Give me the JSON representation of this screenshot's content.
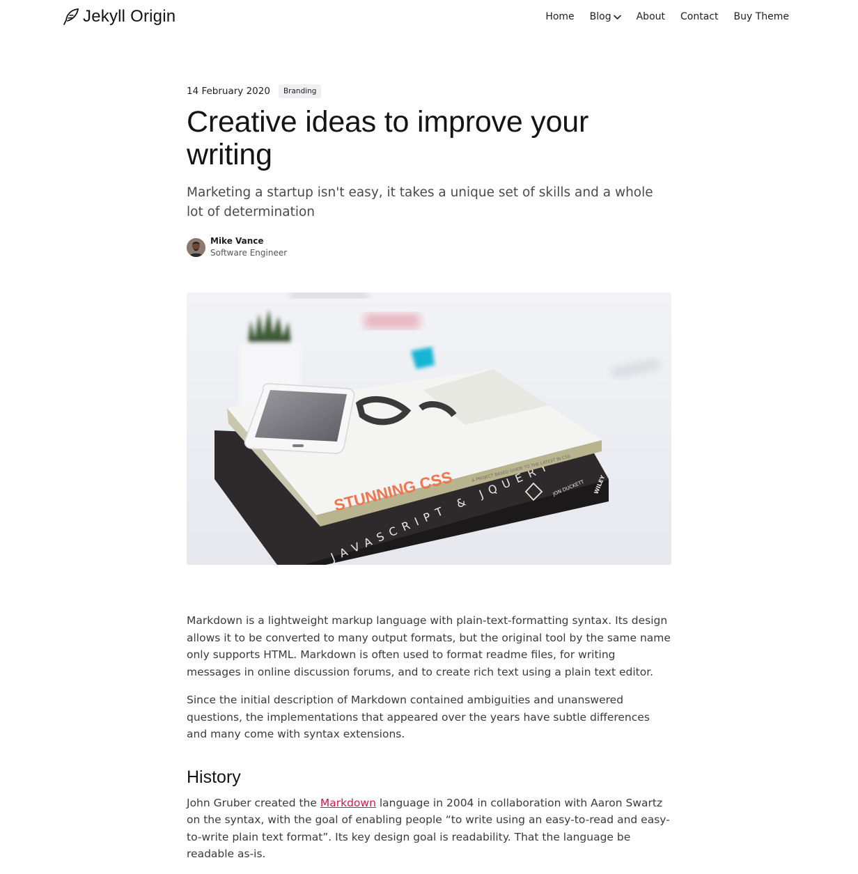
{
  "header": {
    "logo_text": "Jekyll Origin",
    "logo_icon": "quill-icon",
    "nav": [
      {
        "label": "Home"
      },
      {
        "label": "Blog",
        "has_dropdown": true
      },
      {
        "label": "About"
      },
      {
        "label": "Contact"
      },
      {
        "label": "Buy Theme"
      }
    ]
  },
  "post": {
    "date": "14 February 2020",
    "tag": "Branding",
    "title": "Creative ideas to improve your writing",
    "lead": "Marketing a startup isn't easy, it takes a unique set of skills and a whole lot of determination",
    "author": {
      "name": "Mike Vance",
      "role": "Software Engineer"
    },
    "hero_image": {
      "book_top_title": "STUNNING CSS",
      "book_top_subtitle": "A PROJECT BASED GUIDE TO THE LATEST IN CSS",
      "book_bottom_title": "JAVASCRIPT & JQUERY",
      "book_bottom_author": "JON DUCKETT",
      "book_bottom_publisher": "WILEY"
    },
    "body": {
      "p1": "Markdown is a lightweight markup language with plain-text-formatting syntax. Its design allows it to be converted to many output formats, but the original tool by the same name only supports HTML. Markdown is often used to format readme files, for writing messages in online discussion forums, and to create rich text using a plain text editor.",
      "p2": "Since the initial description of Markdown contained ambiguities and unanswered questions, the implementations that appeared over the years have subtle differences and many come with syntax extensions.",
      "h_history": "History",
      "p3_before": "John Gruber created the ",
      "p3_link": "Markdown",
      "p3_after": " language in 2004 in collaboration with Aaron Swartz on the syntax, with the goal of enabling people “to write using an easy-to-read and easy-to-write plain text format”. Its key design goal is readability. That the language be readable as-is."
    }
  },
  "colors": {
    "link": "#d3174f",
    "tag_bg": "#eff0f1",
    "text": "#1e1e1e"
  }
}
